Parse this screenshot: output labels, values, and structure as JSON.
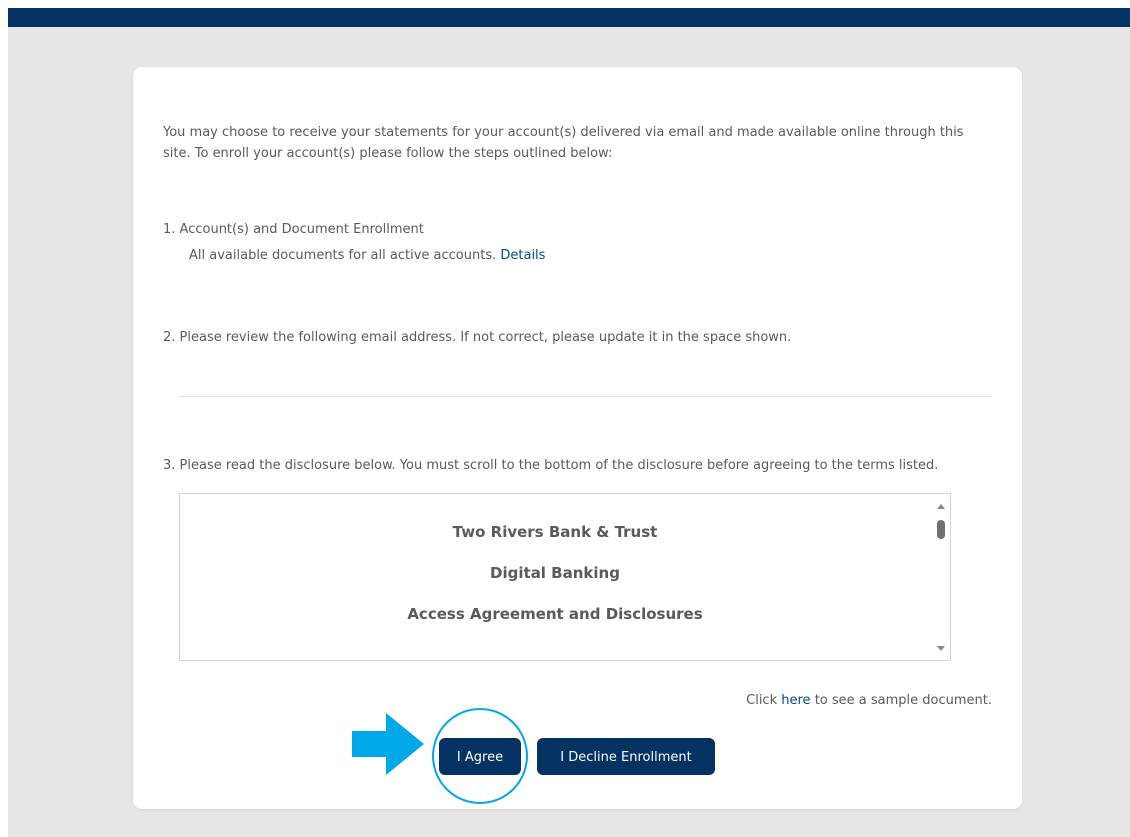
{
  "intro": "You may choose to receive your statements for your account(s) delivered via email and made available online through this site. To enroll your account(s) please follow the steps outlined below:",
  "step1": {
    "title": "1. Account(s) and Document Enrollment",
    "desc": "All available documents for all active accounts.",
    "link": "Details"
  },
  "step2": {
    "title": "2. Please review the following email address. If not correct, please update it in the space shown."
  },
  "step3": {
    "title": "3. Please read the disclosure below. You must scroll to the bottom of the disclosure before agreeing to the terms listed."
  },
  "disclosure": {
    "line1": "Two Rivers Bank & Trust",
    "line2": "Digital Banking",
    "line3": "Access Agreement and Disclosures"
  },
  "sample": {
    "prefix": "Click",
    "link": "here",
    "suffix": "to see a sample document."
  },
  "buttons": {
    "agree": "I Agree",
    "decline": "I Decline Enrollment"
  },
  "colors": {
    "brand": "#033263",
    "link": "#034a8a",
    "highlight": "#00a8e8"
  }
}
